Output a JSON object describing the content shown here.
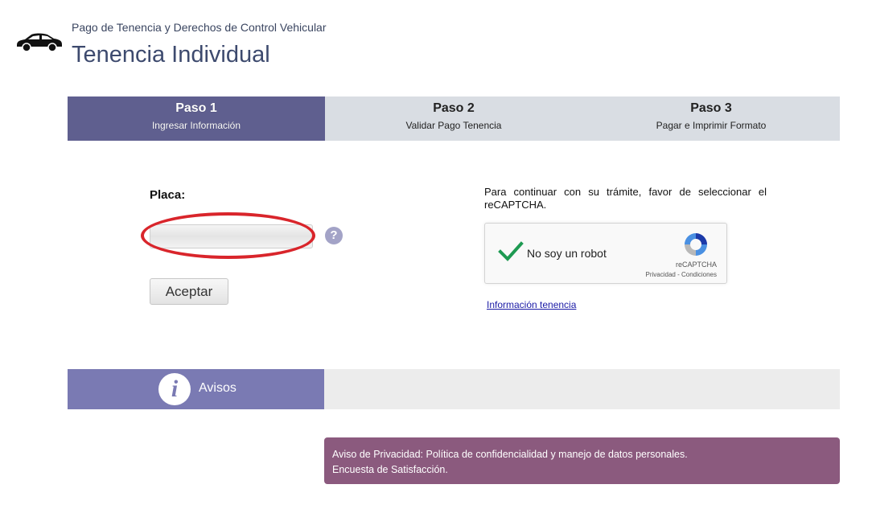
{
  "header": {
    "subtitle": "Pago de Tenencia y Derechos de Control Vehicular",
    "title": "Tenencia Individual",
    "icon": "car-icon"
  },
  "steps": [
    {
      "number": "Paso 1",
      "description": "Ingresar Información",
      "active": true
    },
    {
      "number": "Paso 2",
      "description": "Validar Pago Tenencia",
      "active": false
    },
    {
      "number": "Paso 3",
      "description": "Pagar e Imprimir Formato",
      "active": false
    }
  ],
  "form": {
    "placa_label": "Placa:",
    "placa_value": "",
    "placa_placeholder": "",
    "help_icon": "?",
    "accept_label": "Aceptar"
  },
  "captcha": {
    "note": "Para continuar con su trámite, favor de seleccionar el reCAPTCHA.",
    "checkbox_label": "No soy un robot",
    "brand": "reCAPTCHA",
    "links": "Privacidad - Condiciones",
    "checked": true
  },
  "info_link": "Información tenencia",
  "avisos": {
    "label": "Avisos",
    "icon_glyph": "i"
  },
  "privacy": {
    "line1": "Aviso de Privacidad: Política de confidencialidad y manejo de datos personales.",
    "line2": "Encuesta de Satisfacción."
  },
  "colors": {
    "step_active": "#5f5f8f",
    "step_inactive": "#d9dde3",
    "avisos_tab": "#7a7ab3",
    "privacy_box": "#8b5a7e",
    "highlight": "#d9252b",
    "check": "#1e9a52"
  }
}
